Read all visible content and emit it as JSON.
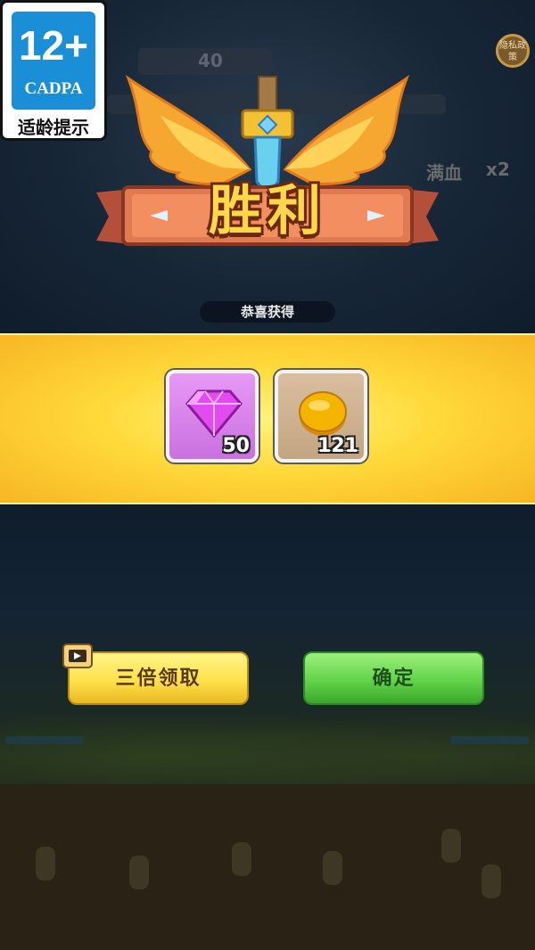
{
  "age_rating": {
    "number": "12+",
    "org": "CADPA",
    "label": "适龄提示"
  },
  "privacy": {
    "label": "隐私政策"
  },
  "hud": {
    "value": "40",
    "tags": [
      "满血",
      "x2"
    ]
  },
  "result": {
    "title": "胜利",
    "subtitle": "恭喜获得"
  },
  "rewards": [
    {
      "icon": "gem-icon",
      "count": "50"
    },
    {
      "icon": "coin-icon",
      "count": "121"
    }
  ],
  "buttons": {
    "triple_claim": "三倍领取",
    "confirm": "确定"
  },
  "colors": {
    "title": "#ffd84a",
    "band": "#ffd93a",
    "gem": "#e14cf0",
    "coin": "#f5b400",
    "confirm": "#62d34a",
    "triple": "#ffe24a"
  }
}
